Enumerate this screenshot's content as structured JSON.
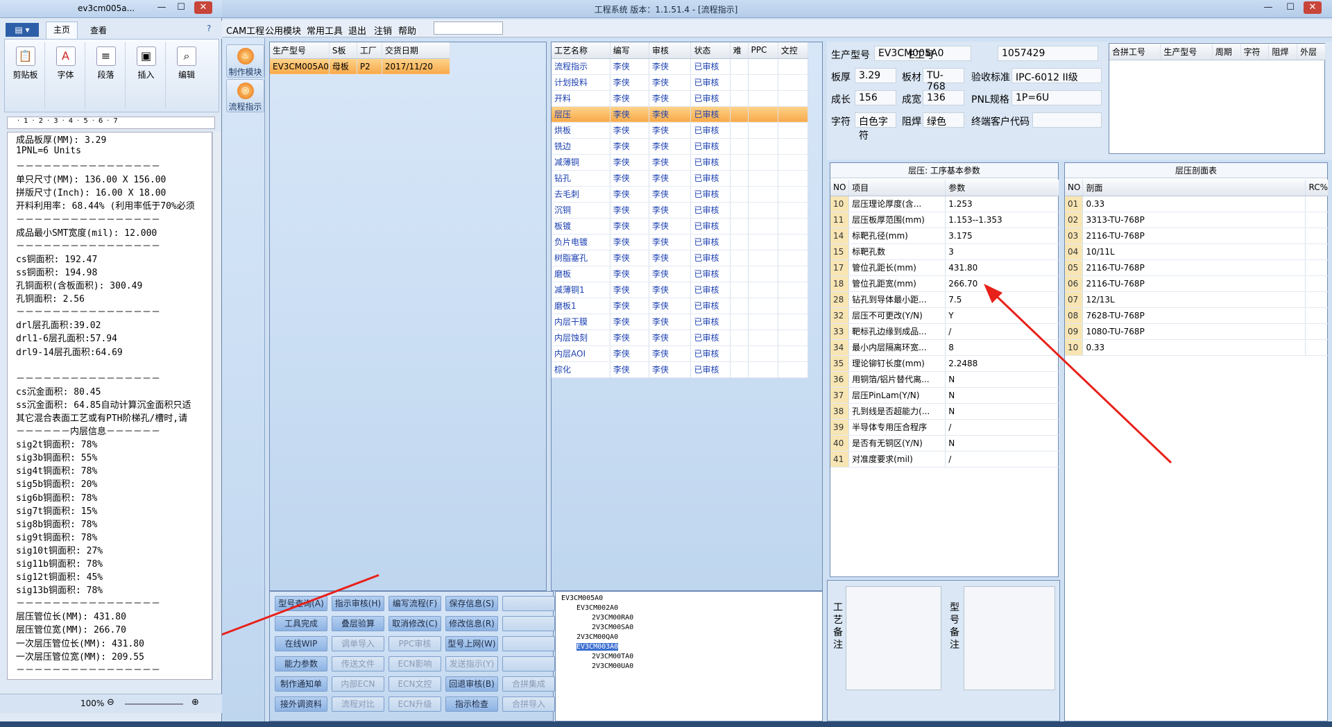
{
  "app": {
    "title": "工程系统   版本：1.1.51.4 - [流程指示]",
    "menus": [
      "CAM工程",
      "公用模块",
      "常用工具",
      "退出",
      "注销",
      "帮助"
    ],
    "modules": [
      "制作模块",
      "流程指示"
    ]
  },
  "word": {
    "title": "ev3cm005a...",
    "tabs": [
      "主页",
      "查看"
    ],
    "groups": [
      "剪贴板",
      "字体",
      "段落",
      "插入",
      "编辑"
    ],
    "lines": [
      "成品板厚(MM): 3.29",
      "1PNL=6 Units",
      "－－－－－－－－－－－－－－－－",
      "单只尺寸(MM): 136.00 X 156.00",
      "拼版尺寸(Inch): 16.00 X 18.00",
      "开料利用率: 68.44% (利用率低于70%必须",
      "－－－－－－－－－－－－－－－－",
      "成品最小SMT宽度(mil): 12.000",
      "－－－－－－－－－－－－－－－－",
      "cs铜面积: 192.47",
      "ss铜面积: 194.98",
      "孔铜面积(含板面积): 300.49",
      "孔铜面积: 2.56",
      "－－－－－－－－－－－－－－－－",
      "drl层孔面积:39.02",
      "drl1-6层孔面积:57.94",
      "drl9-14层孔面积:64.69",
      "",
      "－－－－－－－－－－－－－－－－",
      "cs沉金面积: 80.45",
      "ss沉金面积: 64.85自动计算沉金面积只适",
      "其它混合表面工艺或有PTH阶梯孔/槽时,请",
      "－－－－－－内层信息－－－－－－",
      "sig2t铜面积: 78%",
      "sig3b铜面积: 55%",
      "sig4t铜面积: 78%",
      "sig5b铜面积: 20%",
      "sig6b铜面积: 78%",
      "sig7t铜面积: 15%",
      "sig8b铜面积: 78%",
      "sig9t铜面积: 78%",
      "sig10t铜面积: 27%",
      "sig11b铜面积: 78%",
      "sig12t铜面积: 45%",
      "sig13b铜面积: 78%",
      "－－－－－－－－－－－－－－－－",
      "层压管位长(MM): 431.80",
      "层压管位宽(MM): 266.70",
      "一次层压管位长(MM): 431.80",
      "一次层压管位宽(MM): 209.55",
      "－－－－－－－－－－－－－－－－"
    ],
    "zoom": "100%"
  },
  "order": {
    "headers": [
      "生产型号",
      "S板",
      "工厂",
      "交货日期"
    ],
    "rows": [
      [
        "EV3CM005A0",
        "母板",
        "P2",
        "2017/11/20"
      ]
    ]
  },
  "process": {
    "headers": [
      "工艺名称",
      "编写",
      "审核",
      "状态",
      "难",
      "PPC",
      "文控"
    ],
    "rows": [
      [
        "流程指示",
        "李侠",
        "李侠",
        "已审核"
      ],
      [
        "计划投料",
        "李侠",
        "李侠",
        "已审核"
      ],
      [
        "开料",
        "李侠",
        "李侠",
        "已审核"
      ],
      [
        "层压",
        "李侠",
        "李侠",
        "已审核"
      ],
      [
        "烘板",
        "李侠",
        "李侠",
        "已审核"
      ],
      [
        "铣边",
        "李侠",
        "李侠",
        "已审核"
      ],
      [
        "减薄铜",
        "李侠",
        "李侠",
        "已审核"
      ],
      [
        "钻孔",
        "李侠",
        "李侠",
        "已审核"
      ],
      [
        "去毛刺",
        "李侠",
        "李侠",
        "已审核"
      ],
      [
        "沉铜",
        "李侠",
        "李侠",
        "已审核"
      ],
      [
        "板镀",
        "李侠",
        "李侠",
        "已审核"
      ],
      [
        "负片电镀",
        "李侠",
        "李侠",
        "已审核"
      ],
      [
        "树脂塞孔",
        "李侠",
        "李侠",
        "已审核"
      ],
      [
        "磨板",
        "李侠",
        "李侠",
        "已审核"
      ],
      [
        "减薄铜1",
        "李侠",
        "李侠",
        "已审核"
      ],
      [
        "磨板1",
        "李侠",
        "李侠",
        "已审核"
      ],
      [
        "内层干膜",
        "李侠",
        "李侠",
        "已审核"
      ],
      [
        "内层蚀刻",
        "李侠",
        "李侠",
        "已审核"
      ],
      [
        "内层AOI",
        "李侠",
        "李侠",
        "已审核"
      ],
      [
        "棕化",
        "李侠",
        "李侠",
        "已审核"
      ]
    ],
    "selected": 3
  },
  "info": {
    "fields": [
      {
        "label": "生产型号",
        "value": "EV3CM005A0"
      },
      {
        "label": "E工号",
        "value": "1057429"
      },
      {
        "label": "板厚",
        "value": "3.29"
      },
      {
        "label": "板材",
        "value": "TU-768"
      },
      {
        "label": "验收标准",
        "value": "IPC-6012 II级"
      },
      {
        "label": "成长",
        "value": "156"
      },
      {
        "label": "成宽",
        "value": "136"
      },
      {
        "label": "PNL规格",
        "value": "1P=6U"
      },
      {
        "label": "字符",
        "value": "白色字符"
      },
      {
        "label": "阻焊",
        "value": "绿色"
      },
      {
        "label": "终端客户代码",
        "value": ""
      }
    ],
    "merge_headers": [
      "合拼工号",
      "生产型号",
      "周期",
      "字符",
      "阻焊",
      "外层"
    ]
  },
  "params": {
    "title": "层压: 工序基本参数",
    "headers": [
      "NO",
      "项目",
      "参数"
    ],
    "rows": [
      [
        "10",
        "层压理论厚度(含...",
        "1.253"
      ],
      [
        "11",
        "层压板厚范围(mm)",
        "1.153--1.353"
      ],
      [
        "14",
        "标靶孔径(mm)",
        "3.175"
      ],
      [
        "15",
        "标靶孔数",
        "3"
      ],
      [
        "17",
        "管位孔距长(mm)",
        "431.80"
      ],
      [
        "18",
        "管位孔距宽(mm)",
        "266.70"
      ],
      [
        "28",
        "钻孔到导体最小距...",
        "7.5"
      ],
      [
        "32",
        "层压不可更改(Y/N)",
        "Y"
      ],
      [
        "33",
        "靶标孔边缘到成品...",
        "/"
      ],
      [
        "34",
        "最小内层隔离环宽...",
        "8"
      ],
      [
        "35",
        "理论铆钉长度(mm)",
        "2.2488"
      ],
      [
        "36",
        "用铜箔/铝片替代离...",
        "N"
      ],
      [
        "37",
        "层压PinLam(Y/N)",
        "N"
      ],
      [
        "38",
        "孔到线是否超能力(...",
        "N"
      ],
      [
        "39",
        "半导体专用压合程序",
        "/"
      ],
      [
        "40",
        "是否有无铜区(Y/N)",
        "N"
      ],
      [
        "41",
        "对准度要求(mil)",
        "/"
      ]
    ]
  },
  "stackup": {
    "title": "层压剖面表",
    "headers": [
      "NO",
      "剖面",
      "RC%"
    ],
    "rows": [
      [
        "01",
        "0.33"
      ],
      [
        "02",
        "3313-TU-768P"
      ],
      [
        "03",
        "2116-TU-768P"
      ],
      [
        "04",
        "10/11L"
      ],
      [
        "05",
        "2116-TU-768P"
      ],
      [
        "06",
        "2116-TU-768P"
      ],
      [
        "07",
        "12/13L"
      ],
      [
        "08",
        "7628-TU-768P"
      ],
      [
        "09",
        "1080-TU-768P"
      ],
      [
        "10",
        "0.33"
      ]
    ]
  },
  "buttons": [
    [
      "型号查询(A)",
      "指示审核(H)",
      "编写流程(F)",
      "保存信息(S)",
      ""
    ],
    [
      "工具完成",
      "叠层验算",
      "取消修改(C)",
      "修改信息(R)",
      ""
    ],
    [
      "在线WIP",
      "调单导入",
      "PPC审核",
      "型号上网(W)",
      ""
    ],
    [
      "能力参数",
      "传送文件",
      "ECN影响",
      "发送指示(Y)",
      ""
    ],
    [
      "制作通知单",
      "内部ECN",
      "ECN文控",
      "回退审核(B)",
      "合拼集成"
    ],
    [
      "接外调资料",
      "流程对比",
      "ECN升级",
      "指示检查",
      "合拼导入"
    ]
  ],
  "tree": [
    "EV3CM005A0",
    "EV3CM002A0",
    "2V3CM00RA0",
    "2V3CM00SA0",
    "2V3CM00QA0",
    "EV3CM003A0",
    "2V3CM00TA0",
    "2V3CM00UA0"
  ],
  "notes": {
    "process_label": "工艺备注",
    "model_label": "型号备注"
  }
}
